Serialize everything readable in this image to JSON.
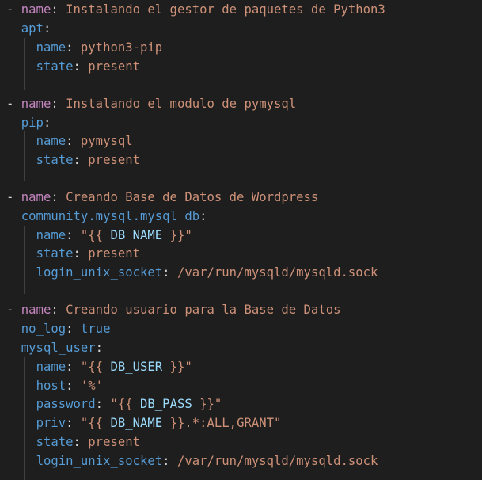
{
  "tasks": [
    {
      "dash": "-",
      "name_key": "name",
      "name_value": "Instalando el gestor de paquetes de Python3",
      "module": "apt",
      "params": [
        {
          "key": "name",
          "value": "python3-pip"
        },
        {
          "key": "state",
          "value": "present"
        }
      ]
    },
    {
      "dash": "-",
      "name_key": "name",
      "name_value": "Instalando el modulo de pymysql",
      "module": "pip",
      "params": [
        {
          "key": "name",
          "value": "pymysql"
        },
        {
          "key": "state",
          "value": "present"
        }
      ]
    },
    {
      "dash": "-",
      "name_key": "name",
      "name_value": "Creando Base de Datos de Wordpress",
      "module": "community.mysql.mysql_db",
      "params": [
        {
          "key": "name",
          "value_prefix": "\"{{ ",
          "value_var": "DB_NAME",
          "value_suffix": " }}\""
        },
        {
          "key": "state",
          "value": "present"
        },
        {
          "key": "login_unix_socket",
          "value": "/var/run/mysqld/mysqld.sock"
        }
      ]
    },
    {
      "dash": "-",
      "name_key": "name",
      "name_value": "Creando usuario para la Base de Datos",
      "extra_key": "no_log",
      "extra_value": "true",
      "module": "mysql_user",
      "params": [
        {
          "key": "name",
          "value_prefix": "\"{{ ",
          "value_var": "DB_USER",
          "value_suffix": " }}\""
        },
        {
          "key": "host",
          "value": "'%'"
        },
        {
          "key": "password",
          "value_prefix": "\"{{ ",
          "value_var": "DB_PASS",
          "value_suffix": " }}\""
        },
        {
          "key": "priv",
          "value_prefix": "\"{{ ",
          "value_var": "DB_NAME",
          "value_suffix": " }}.*:ALL,GRANT\""
        },
        {
          "key": "state",
          "value": "present"
        },
        {
          "key": "login_unix_socket",
          "value": "/var/run/mysqld/mysqld.sock"
        }
      ]
    }
  ],
  "colors": {
    "background": "#1e1e1e",
    "key": "#569cd6",
    "name_key": "#c586c0",
    "string": "#ce9178",
    "template_var": "#9cdcfe",
    "boolean": "#569cd6",
    "punctuation": "#d4d4d4",
    "indent_guide": "#404040"
  }
}
